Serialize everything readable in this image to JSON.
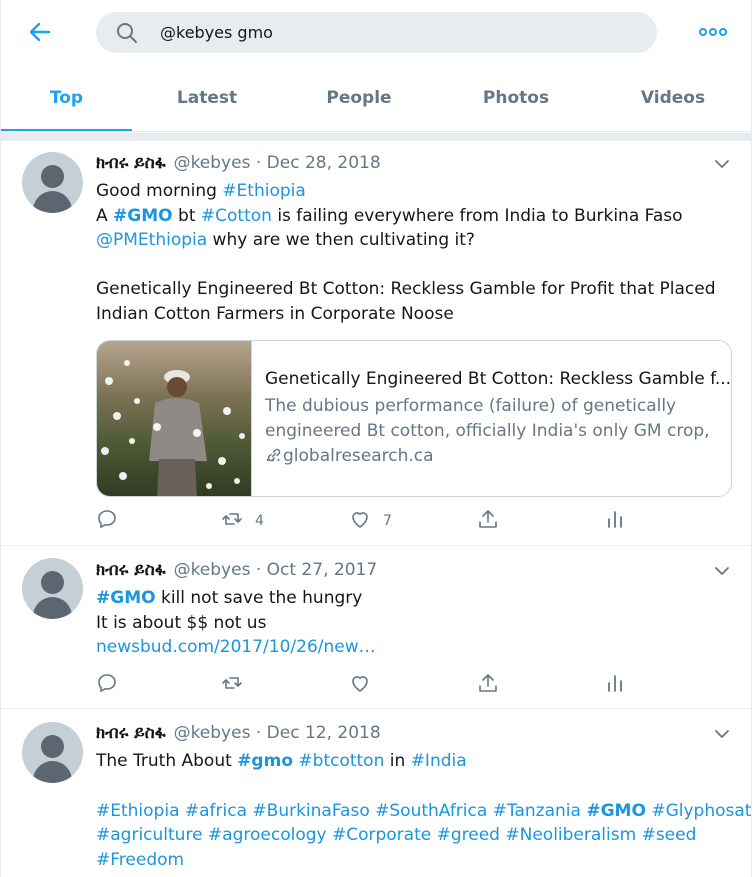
{
  "search": {
    "query": "@kebyes gmo"
  },
  "tabs": [
    "Top",
    "Latest",
    "People",
    "Photos",
    "Videos"
  ],
  "tweets": [
    {
      "name": "ክብሩ ይስፋ",
      "meta": "@kebyes · Dec 28, 2018",
      "l1": "Good morning ",
      "l1_tag": "#Ethiopia",
      "l2a": "A ",
      "l2_gmo": "#GMO",
      "l2b": " bt ",
      "l2_cotton": "#Cotton",
      "l2c": " is failing everywhere from India to Burkina Faso",
      "l3_mention": "@PMEthiopia",
      "l3": " why are we then cultivating it?",
      "l4": "Genetically Engineered Bt Cotton: Reckless Gamble for Profit that Placed Indian Cotton Farmers in Corporate Noose",
      "card": {
        "title": "Genetically Engineered Bt Cotton: Reckless Gamble f...",
        "desc": "The dubious performance (failure) of genetically engineered Bt cotton, officially India's only GM crop, ...",
        "domain": "globalresearch.ca"
      },
      "retweets": "4",
      "likes": "7"
    },
    {
      "name": "ክብሩ ይስፋ",
      "meta": "@kebyes · Oct 27, 2017",
      "l1_tag": "#GMO",
      "l1": " kill not save the hungry",
      "l2": "It is about $$ not us",
      "l3_link": "newsbud.com/2017/10/26/new…"
    },
    {
      "name": "ክብሩ ይስፋ",
      "meta": "@kebyes · Dec 12, 2018",
      "l1a": "The Truth About ",
      "l1_gmo": "#gmo",
      "l1_btcotton": "#btcotton",
      "l1b": " in ",
      "l1_india": "#India",
      "tags1": "#Ethiopia #africa #BurkinaFaso #SouthAfrica #Tanzania ",
      "tags1_gmo": "#GMO",
      "tags1b": " #Glyphosate",
      "tags2": "#agriculture #agroecology #Corporate #greed #Neoliberalism #seed",
      "tags3": "#Freedom"
    }
  ],
  "colors": {
    "accent": "#1da1f2",
    "link": "#1b95e0",
    "secondary": "#657786",
    "divider": "#e6ecf0"
  },
  "icons": [
    "back-arrow-icon",
    "search-icon",
    "more-icon",
    "chevron-down-icon",
    "reply-icon",
    "retweet-icon",
    "like-icon",
    "share-icon",
    "analytics-icon",
    "link-icon"
  ]
}
